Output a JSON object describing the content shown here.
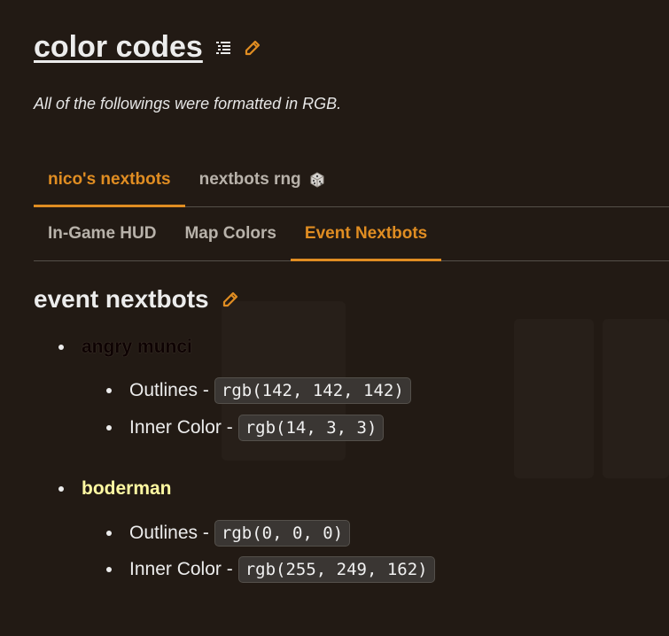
{
  "page": {
    "title": "color codes",
    "subtitle": "All of the followings were formatted in RGB."
  },
  "tabs": [
    {
      "label": "nico's nextbots",
      "active": true
    },
    {
      "label": "nextbots rng",
      "active": false,
      "icon": "dice-icon"
    }
  ],
  "subtabs": [
    {
      "label": "In-Game HUD",
      "active": false
    },
    {
      "label": "Map Colors",
      "active": false
    },
    {
      "label": "Event Nextbots",
      "active": true
    }
  ],
  "section": {
    "title": "event nextbots"
  },
  "bots": [
    {
      "name": "angry munci",
      "name_color": "#0e0303",
      "properties": [
        {
          "label": "Outlines -",
          "value": "rgb(142, 142, 142)"
        },
        {
          "label": "Inner Color -",
          "value": "rgb(14, 3, 3)"
        }
      ]
    },
    {
      "name": "boderman",
      "name_color": "#fff9a2",
      "properties": [
        {
          "label": "Outlines -",
          "value": "rgb(0, 0, 0)"
        },
        {
          "label": "Inner Color -",
          "value": "rgb(255, 249, 162)"
        }
      ]
    }
  ],
  "colors": {
    "accent": "#e08d22",
    "background": "#221a14"
  }
}
